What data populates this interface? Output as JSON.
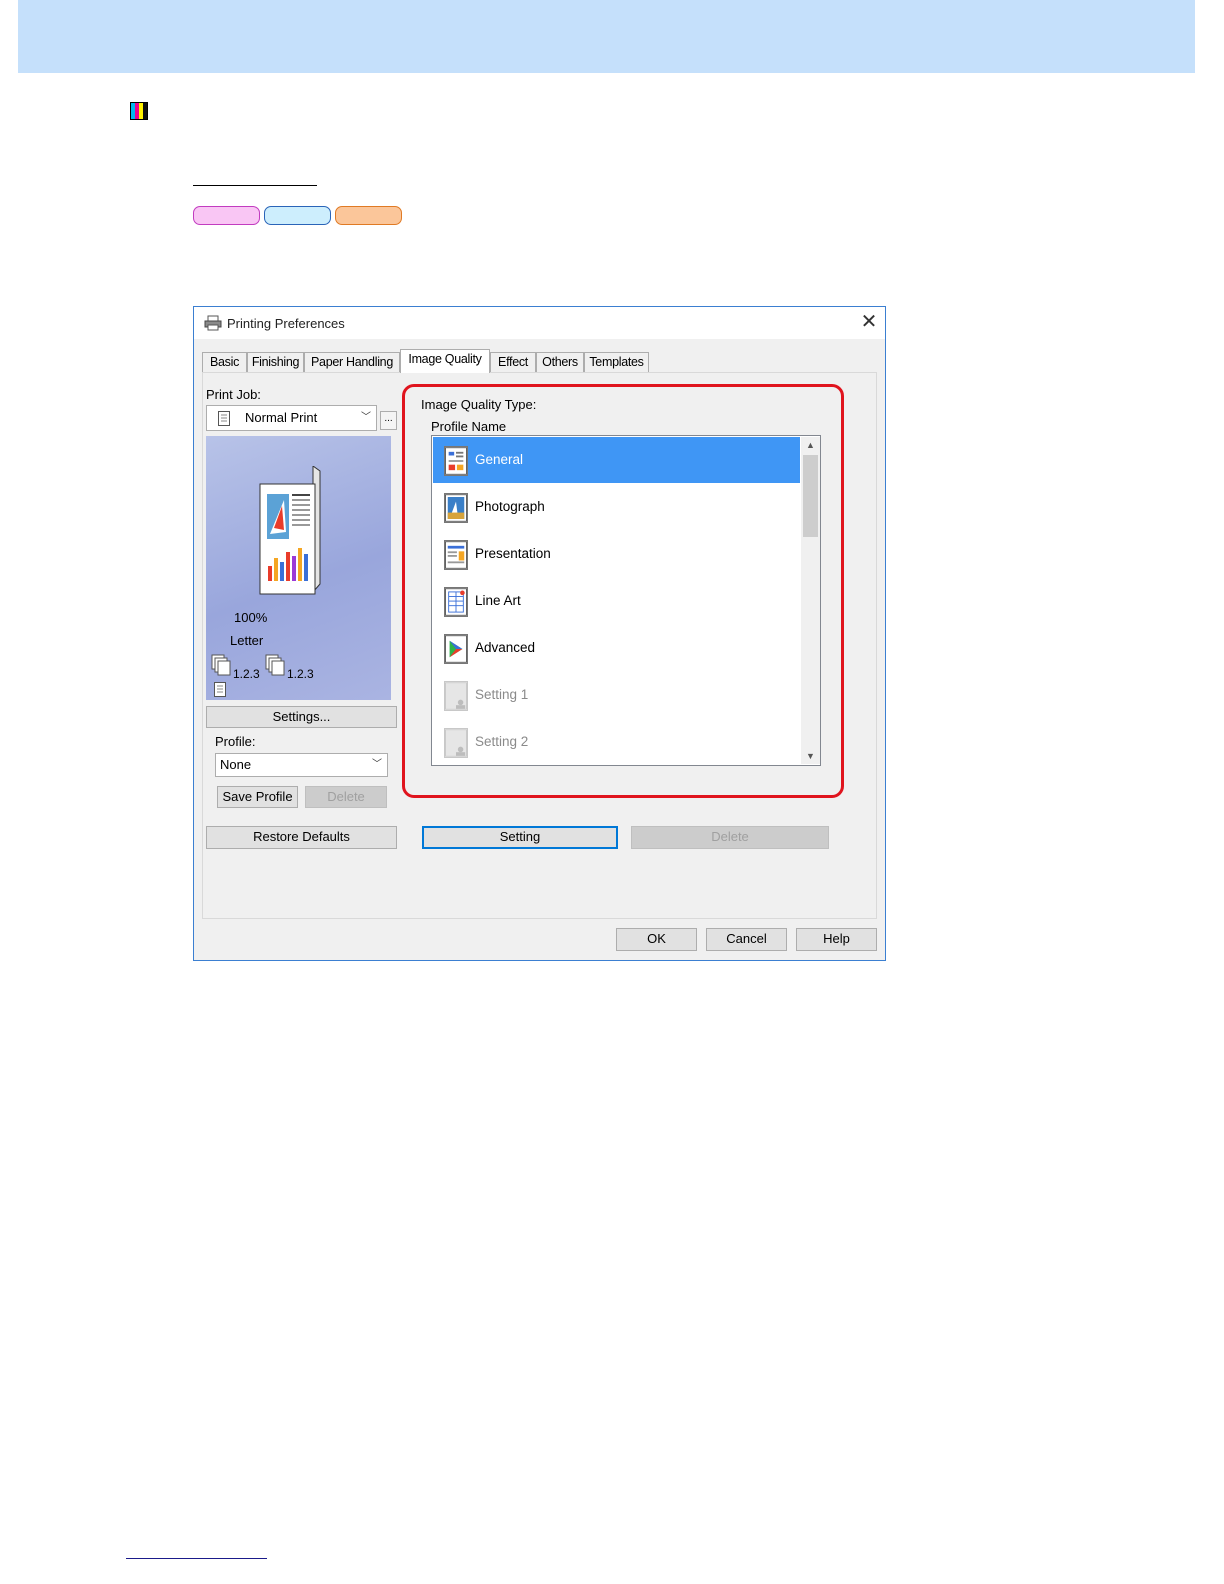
{
  "colors": {
    "header_band": "#c5e0fb",
    "pill_1": "#f9c6f4",
    "pill_2": "#cdeefd",
    "pill_3": "#fbc69a",
    "selection": "#3f96f5",
    "highlight_frame": "#e0141e"
  },
  "dialog": {
    "title": "Printing Preferences",
    "close_icon": "close-icon",
    "tabs": [
      {
        "label": "Basic",
        "active": false
      },
      {
        "label": "Finishing",
        "active": false
      },
      {
        "label": "Paper Handling",
        "active": false
      },
      {
        "label": "Image Quality",
        "active": true
      },
      {
        "label": "Effect",
        "active": false
      },
      {
        "label": "Others",
        "active": false
      },
      {
        "label": "Templates",
        "active": false
      }
    ],
    "print_job": {
      "label": "Print Job:",
      "value": "Normal Print",
      "more_button": "..."
    },
    "preview": {
      "zoom": "100%",
      "paper_size": "Letter",
      "collate_1": "1.2.3",
      "collate_2": "1.2.3"
    },
    "settings_button": "Settings...",
    "profile": {
      "label": "Profile:",
      "value": "None",
      "save_button": "Save Profile",
      "delete_button": "Delete"
    },
    "restore_defaults_button": "Restore Defaults",
    "image_quality": {
      "type_label": "Image Quality Type:",
      "profile_name_label": "Profile Name",
      "items": [
        {
          "label": "General",
          "icon": "general-icon",
          "selected": true,
          "enabled": true
        },
        {
          "label": "Photograph",
          "icon": "photograph-icon",
          "selected": false,
          "enabled": true
        },
        {
          "label": "Presentation",
          "icon": "presentation-icon",
          "selected": false,
          "enabled": true
        },
        {
          "label": "Line Art",
          "icon": "line-art-icon",
          "selected": false,
          "enabled": true
        },
        {
          "label": "Advanced",
          "icon": "advanced-icon",
          "selected": false,
          "enabled": true
        },
        {
          "label": "Setting 1",
          "icon": "user-setting-icon",
          "selected": false,
          "enabled": false
        },
        {
          "label": "Setting 2",
          "icon": "user-setting-icon",
          "selected": false,
          "enabled": false
        }
      ],
      "setting_button": "Setting",
      "delete_button": "Delete"
    },
    "footer": {
      "ok": "OK",
      "cancel": "Cancel",
      "help": "Help"
    }
  }
}
